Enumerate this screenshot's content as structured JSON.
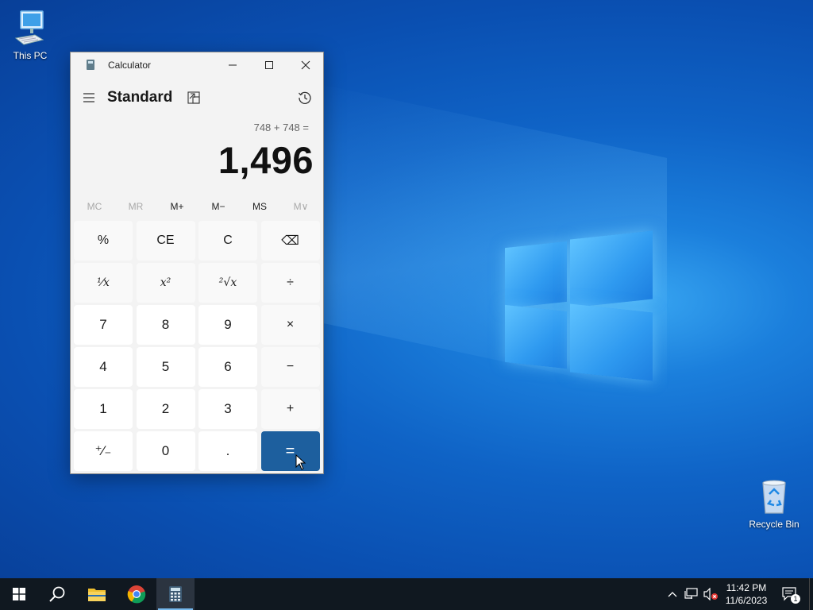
{
  "desktop": {
    "icons": [
      {
        "label": "This PC"
      },
      {
        "label": "Recycle Bin"
      }
    ]
  },
  "calculator": {
    "window_title": "Calculator",
    "mode": "Standard",
    "expression": "748 + 748 =",
    "result": "1,496",
    "memory": [
      "MC",
      "MR",
      "M+",
      "M−",
      "MS",
      "M∨"
    ],
    "keys": [
      [
        "%",
        "CE",
        "C",
        "⌫"
      ],
      [
        "¹⁄x",
        "x²",
        "²√x",
        "÷"
      ],
      [
        "7",
        "8",
        "9",
        "×"
      ],
      [
        "4",
        "5",
        "6",
        "−"
      ],
      [
        "1",
        "2",
        "3",
        "+"
      ],
      [
        "⁺⁄₋",
        "0",
        ".",
        "="
      ]
    ]
  },
  "taskbar": {
    "apps": [
      "start",
      "search",
      "file-explorer",
      "chrome",
      "calculator"
    ],
    "time": "11:42 PM",
    "date": "11/6/2023",
    "notification_count": "1"
  },
  "colors": {
    "accent": "#1d5f9e",
    "taskbar": "#101820",
    "window_bg": "#f3f3f3"
  }
}
